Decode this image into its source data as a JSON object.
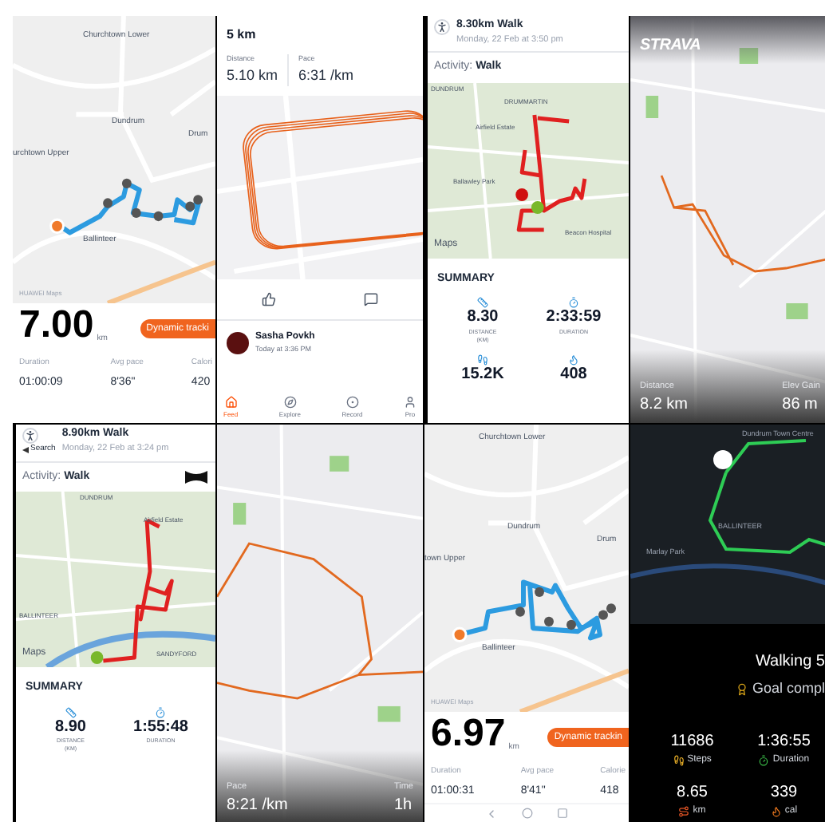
{
  "tiles": [
    {
      "kind": "huawei",
      "map_labels": [
        "Churchtown Lower",
        "Dundrum",
        "urchtown Upper",
        "Ballinteer",
        "Drum"
      ],
      "map_credit": "HUAWEI Maps",
      "distance": "7.00",
      "unit": "km",
      "tracking_button": "Dynamic tracki",
      "stats": [
        {
          "label": "Duration",
          "value": "01:00:09"
        },
        {
          "label": "Avg pace",
          "value": "8'36\""
        },
        {
          "label": "Calori",
          "value": "420"
        }
      ]
    },
    {
      "kind": "strava_feed",
      "title": "5 km",
      "stats": [
        {
          "label": "Distance",
          "value": "5.10 km"
        },
        {
          "label": "Pace",
          "value": "6:31 /km"
        }
      ],
      "athlete": "Sasha Povkh",
      "time": "Today at 3:36 PM",
      "nav": [
        {
          "label": "Feed",
          "selected": true
        },
        {
          "label": "Explore",
          "selected": false
        },
        {
          "label": "Record",
          "selected": false
        },
        {
          "label": "Pro",
          "selected": false
        }
      ]
    },
    {
      "kind": "ua",
      "title": "8.30km Walk",
      "date": "Monday, 22 Feb at 3:50 pm",
      "activity_label": "Activity:",
      "activity": "Walk",
      "map_labels": [
        "DUNDRUM",
        "DRUMMARTIN",
        "Airfield Estate",
        "Ballawley Park",
        "Beacon Hospital"
      ],
      "map_credit": "Maps",
      "summary": "SUMMARY",
      "stats": [
        {
          "kind": "distance",
          "value": "8.30",
          "label": "DISTANCE",
          "sub": "(KM)"
        },
        {
          "kind": "duration",
          "value": "2:33:59",
          "label": "DURATION"
        },
        {
          "kind": "steps",
          "value": "15.2K"
        },
        {
          "kind": "calories",
          "value": "408"
        }
      ]
    },
    {
      "kind": "strava_map",
      "logo": "STRAVA",
      "stats": [
        {
          "label": "Distance",
          "value": "8.2 km"
        },
        {
          "label": "Elev Gain",
          "value": "86 m"
        }
      ]
    },
    {
      "kind": "ua",
      "title": "8.90km Walk",
      "date": "Monday, 22 Feb at 3:24 pm",
      "back": "Search",
      "activity_label": "Activity:",
      "activity": "Walk",
      "map_labels": [
        "DUNDRUM",
        "Airfield Estate",
        "BALLINTEER",
        "SANDYFORD"
      ],
      "map_credit": "Maps",
      "summary": "SUMMARY",
      "stats": [
        {
          "kind": "distance",
          "value": "8.90",
          "label": "DISTANCE",
          "sub": "(KM)"
        },
        {
          "kind": "duration",
          "value": "1:55:48",
          "label": "DURATION"
        }
      ]
    },
    {
      "kind": "strava_map",
      "stats": [
        {
          "label": "Pace",
          "value": "8:21 /km"
        },
        {
          "label": "Time",
          "value": "1h"
        }
      ]
    },
    {
      "kind": "huawei",
      "map_labels": [
        "Churchtown Lower",
        "Dundrum",
        "town Upper",
        "Ballinteer",
        "Drum"
      ],
      "map_credit": "HUAWEI Maps",
      "distance": "6.97",
      "unit": "km",
      "tracking_button": "Dynamic trackin",
      "stats": [
        {
          "label": "Duration",
          "value": "01:00:31"
        },
        {
          "label": "Avg pace",
          "value": "8'41\""
        },
        {
          "label": "Calorie",
          "value": "418"
        }
      ],
      "nav_bar": true
    },
    {
      "kind": "dark",
      "map_labels": [
        "Dundrum Town Centre",
        "BALLINTEER",
        "Marlay Park"
      ],
      "title": "Walking 5",
      "goal": "Goal compl",
      "stats": [
        {
          "kind": "steps",
          "value": "11686",
          "label": "Steps"
        },
        {
          "kind": "duration",
          "value": "1:36:55",
          "label": "Duration"
        },
        {
          "kind": "km",
          "value": "8.65",
          "label": "km"
        },
        {
          "kind": "cal",
          "value": "339",
          "label": "cal"
        }
      ]
    }
  ]
}
